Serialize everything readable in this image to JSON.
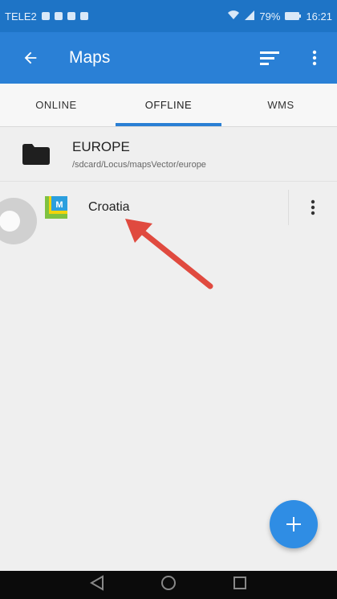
{
  "status_bar": {
    "carrier": "TELE2",
    "battery": "79%",
    "time": "16:21"
  },
  "toolbar": {
    "title": "Maps",
    "back_icon": "arrow-left-icon",
    "sort_icon": "sort-icon",
    "more_icon": "more-vertical-icon"
  },
  "tabs": [
    {
      "label": "ONLINE",
      "active": false
    },
    {
      "label": "OFFLINE",
      "active": true
    },
    {
      "label": "WMS",
      "active": false
    }
  ],
  "folder": {
    "name": "EUROPE",
    "path": "/sdcard/Locus/mapsVector/europe"
  },
  "map_item": {
    "name": "Croatia",
    "logo_letter": "M"
  },
  "colors": {
    "primary": "#2a80d6",
    "status_bar": "#1e74c6",
    "accent": "#2f8de4",
    "annotation_arrow": "#e04a3f"
  },
  "fab": {
    "icon": "plus-icon"
  },
  "nav": {
    "back_icon": "nav-back-icon",
    "home_icon": "nav-home-icon",
    "recents_icon": "nav-recents-icon"
  }
}
